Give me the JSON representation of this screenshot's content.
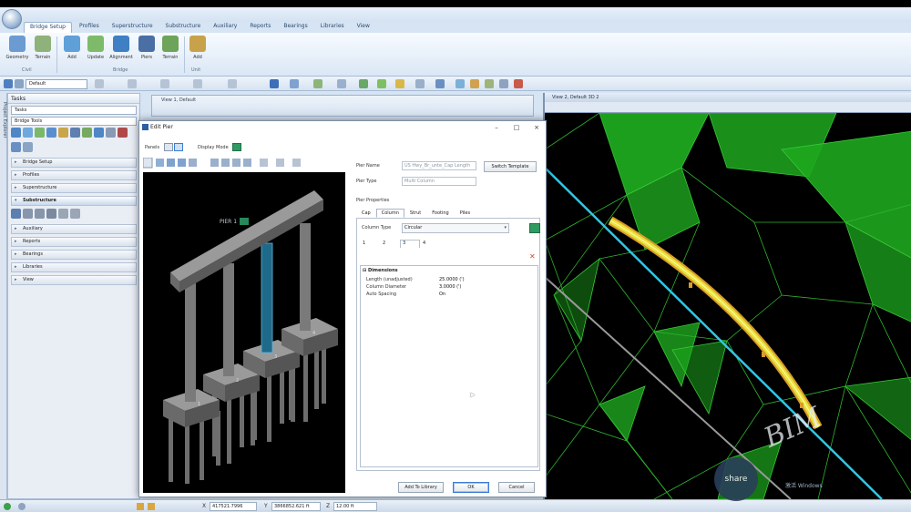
{
  "ribbon": {
    "tabs": [
      "Bridge Setup",
      "Profiles",
      "Superstructure",
      "Substructure",
      "Auxiliary",
      "Reports",
      "Bearings",
      "Libraries",
      "View"
    ],
    "active_tab": 0,
    "buttons": [
      {
        "label": "Geometry",
        "color": "#6b9bd1"
      },
      {
        "label": "Terrain",
        "color": "#8fb27a"
      },
      {
        "label": "Add",
        "color": "#5fa0d8"
      },
      {
        "label": "Update",
        "color": "#7dbb6a"
      },
      {
        "label": "Alignment",
        "color": "#3f7fc4"
      },
      {
        "label": "Piers",
        "color": "#4a6fa5"
      },
      {
        "label": "Terrain",
        "color": "#6ea35a"
      },
      {
        "label": "Add",
        "color": "#c8a24b"
      }
    ],
    "groups": [
      "Civil",
      "Bridge",
      "Unit"
    ]
  },
  "toolbar": {
    "level": "Default"
  },
  "tasks": {
    "title": "Tasks",
    "combo": "Tasks",
    "subcombo": "Bridge Tools",
    "sections": [
      "Bridge Setup",
      "Profiles",
      "Superstructure",
      "Substructure",
      "Auxiliary",
      "Reports",
      "Bearings",
      "Libraries",
      "View"
    ],
    "open_section": "Substructure",
    "explorer_label": "Project Explorer"
  },
  "view1": {
    "title": "View 1, Default"
  },
  "view2": {
    "title": "View 2, Default 3D 2"
  },
  "dialog": {
    "title": "Edit Pier",
    "panels_label": "Panels",
    "display_mode_label": "Display Mode",
    "pier_name_label": "Pier Name",
    "pier_name_value": "US Hwy_Br_unte_Cap Length",
    "switch_template": "Switch Template",
    "pier_type_label": "Pier Type",
    "pier_type_value": "Multi Column",
    "pier_properties_label": "Pier Properties",
    "tabs": [
      "Cap",
      "Column",
      "Strut",
      "Footing",
      "Piles"
    ],
    "active_tab": 1,
    "column_type_label": "Column Type",
    "column_type_value": "Circular",
    "column_tabs": [
      "1",
      "2",
      "3",
      "4"
    ],
    "active_column_tab": 2,
    "category": "Dimensions",
    "properties": [
      {
        "key": "Length (unadjusted)",
        "value": "25.0000 (')"
      },
      {
        "key": "Column Diameter",
        "value": "3.0000 (')"
      },
      {
        "key": "Auto Spacing",
        "value": "On"
      }
    ],
    "add_to_library": "Add To Library",
    "ok": "OK",
    "cancel": "Cancel",
    "model_label": "PIER 1"
  },
  "statusbar": {
    "x_label": "X",
    "x_value": "417521.7996",
    "y_label": "Y",
    "y_value": "3866852.621 ft",
    "z_label": "Z",
    "z_value": "12.00 ft"
  },
  "watermark": {
    "logo_text": "share",
    "brand_text": "BIM",
    "os_text": "激活 Windows"
  },
  "colors": {
    "ribbon_bg": "#dbe7f5",
    "terrain_green": "#1ea81e",
    "bridge_yellow": "#e8e23a",
    "alignment_cyan": "#2fc7e6",
    "selected_column": "#1f6a8a"
  }
}
